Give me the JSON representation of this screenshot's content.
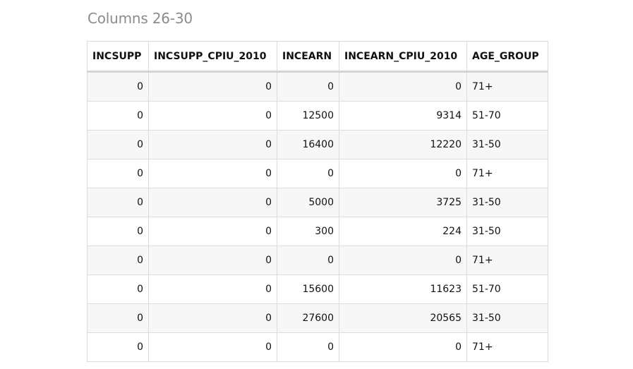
{
  "caption": "Columns 26-30",
  "table": {
    "columns": [
      "INCSUPP",
      "INCSUPP_CPIU_2010",
      "INCEARN",
      "INCEARN_CPIU_2010",
      "AGE_GROUP"
    ],
    "rows": [
      [
        "0",
        "0",
        "0",
        "0",
        "71+"
      ],
      [
        "0",
        "0",
        "12500",
        "9314",
        "51-70"
      ],
      [
        "0",
        "0",
        "16400",
        "12220",
        "31-50"
      ],
      [
        "0",
        "0",
        "0",
        "0",
        "71+"
      ],
      [
        "0",
        "0",
        "5000",
        "3725",
        "31-50"
      ],
      [
        "0",
        "0",
        "300",
        "224",
        "31-50"
      ],
      [
        "0",
        "0",
        "0",
        "0",
        "71+"
      ],
      [
        "0",
        "0",
        "15600",
        "11623",
        "51-70"
      ],
      [
        "0",
        "0",
        "27600",
        "20565",
        "31-50"
      ],
      [
        "0",
        "0",
        "0",
        "0",
        "71+"
      ]
    ]
  }
}
